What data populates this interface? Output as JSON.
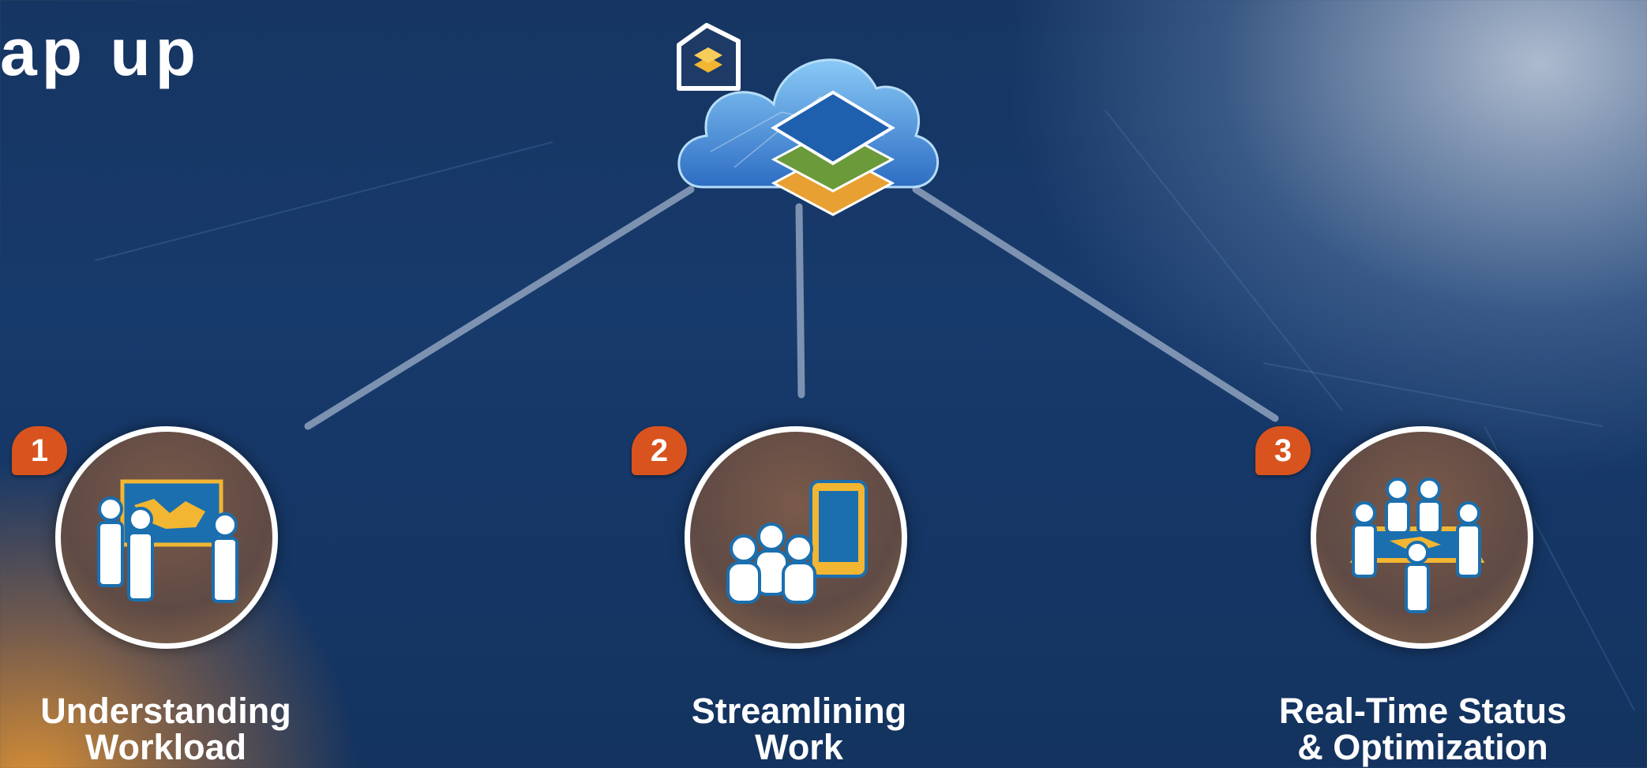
{
  "title": "ap up",
  "items": [
    {
      "number": "1",
      "label_line1": "Understanding",
      "label_line2": "Workload",
      "icon": "people-map-board-icon"
    },
    {
      "number": "2",
      "label_line1": "Streamlining",
      "label_line2": "Work",
      "icon": "people-mobile-device-icon"
    },
    {
      "number": "3",
      "label_line1": "Real-Time Status",
      "label_line2": "& Optimization",
      "icon": "people-around-table-icon"
    }
  ],
  "colors": {
    "badge": "#d9531e",
    "icon_gold": "#f2b632",
    "icon_blue": "#1b6fae",
    "background": "#163562"
  }
}
